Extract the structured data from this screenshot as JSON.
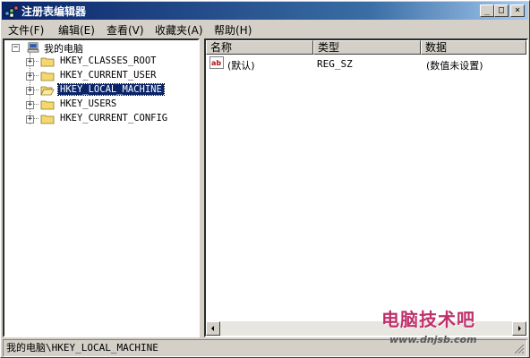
{
  "window": {
    "title": "注册表编辑器",
    "min_glyph": "_",
    "max_glyph": "□",
    "close_glyph": "×"
  },
  "menu": [
    {
      "label": "文件(F)"
    },
    {
      "label": "编辑(E)"
    },
    {
      "label": "查看(V)"
    },
    {
      "label": "收藏夹(A)"
    },
    {
      "label": "帮助(H)"
    }
  ],
  "tree": {
    "root": {
      "label": "我的电脑",
      "expander": "−"
    },
    "nodes": [
      {
        "label": "HKEY_CLASSES_ROOT",
        "expander": "+"
      },
      {
        "label": "HKEY_CURRENT_USER",
        "expander": "+"
      },
      {
        "label": "HKEY_LOCAL_MACHINE",
        "expander": "+",
        "selected": true
      },
      {
        "label": "HKEY_USERS",
        "expander": "+"
      },
      {
        "label": "HKEY_CURRENT_CONFIG",
        "expander": "+"
      }
    ]
  },
  "list": {
    "columns": [
      "名称",
      "类型",
      "数据"
    ],
    "rows": [
      {
        "icon": "string-value-icon",
        "icon_text": "ab",
        "name": "(默认)",
        "type": "REG_SZ",
        "data": "(数值未设置)"
      }
    ]
  },
  "statusbar": {
    "path": "我的电脑\\HKEY_LOCAL_MACHINE"
  },
  "watermark": {
    "title": "电脑技术吧",
    "url": "www.dnjsb.com"
  },
  "colors": {
    "titlebar_start": "#0a246a",
    "selection": "#0a246a",
    "folder": "#f5d76e",
    "watermark": "#c0306b"
  }
}
